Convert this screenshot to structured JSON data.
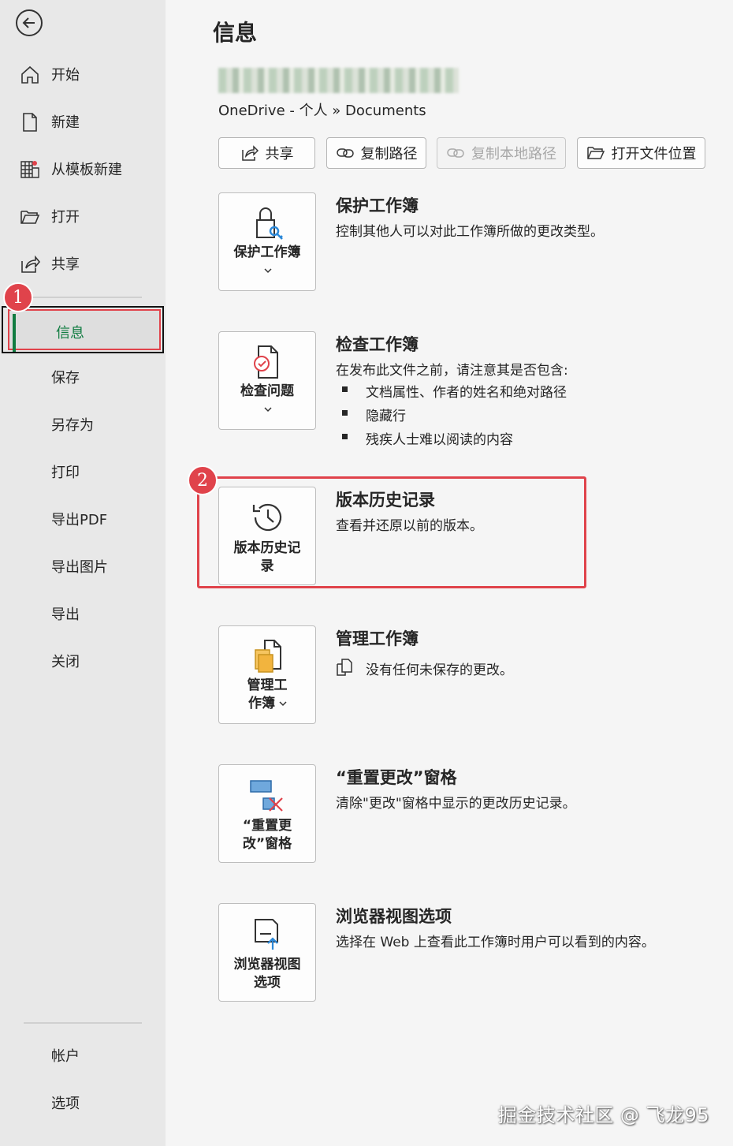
{
  "sidebar": {
    "items": [
      {
        "label": "开始"
      },
      {
        "label": "新建"
      },
      {
        "label": "从模板新建"
      },
      {
        "label": "打开"
      },
      {
        "label": "共享"
      },
      {
        "label": "信息"
      },
      {
        "label": "保存"
      },
      {
        "label": "另存为"
      },
      {
        "label": "打印"
      },
      {
        "label": "导出PDF"
      },
      {
        "label": "导出图片"
      },
      {
        "label": "导出"
      },
      {
        "label": "关闭"
      }
    ],
    "bottom": [
      {
        "label": "帐户"
      },
      {
        "label": "选项"
      }
    ],
    "badge1": "1"
  },
  "main": {
    "title": "信息",
    "path": "OneDrive - 个人 » Documents",
    "toolbar": {
      "share": "共享",
      "copy_path": "复制路径",
      "copy_local_path": "复制本地路径",
      "open_location": "打开文件位置"
    },
    "sections": {
      "protect": {
        "card_label": "保护工作簿",
        "title": "保护工作簿",
        "desc": "控制其他人可以对此工作簿所做的更改类型。"
      },
      "inspect": {
        "card_label": "检查问题",
        "title": "检查工作簿",
        "desc": "在发布此文件之前，请注意其是否包含:",
        "bullets": [
          "文档属性、作者的姓名和绝对路径",
          "隐藏行",
          "残疾人士难以阅读的内容"
        ]
      },
      "version": {
        "card_label_1": "版本历史记",
        "card_label_2": "录",
        "title": "版本历史记录",
        "desc": "查看并还原以前的版本。",
        "badge": "2"
      },
      "manage": {
        "card_label_1": "管理工",
        "card_label_2": "作簿",
        "title": "管理工作簿",
        "desc": "没有任何未保存的更改。"
      },
      "reset": {
        "card_label_1": "“重置更",
        "card_label_2": "改”窗格",
        "title": "“重置更改”窗格",
        "desc": "清除\"更改\"窗格中显示的更改历史记录。"
      },
      "browser": {
        "card_label_1": "浏览器视图",
        "card_label_2": "选项",
        "title": "浏览器视图选项",
        "desc": "选择在 Web 上查看此工作簿时用户可以看到的内容。"
      }
    }
  },
  "watermark": "掘金技术社区 @ 飞龙95",
  "colors": {
    "accent": "#107c41",
    "highlight": "#e0434b"
  }
}
